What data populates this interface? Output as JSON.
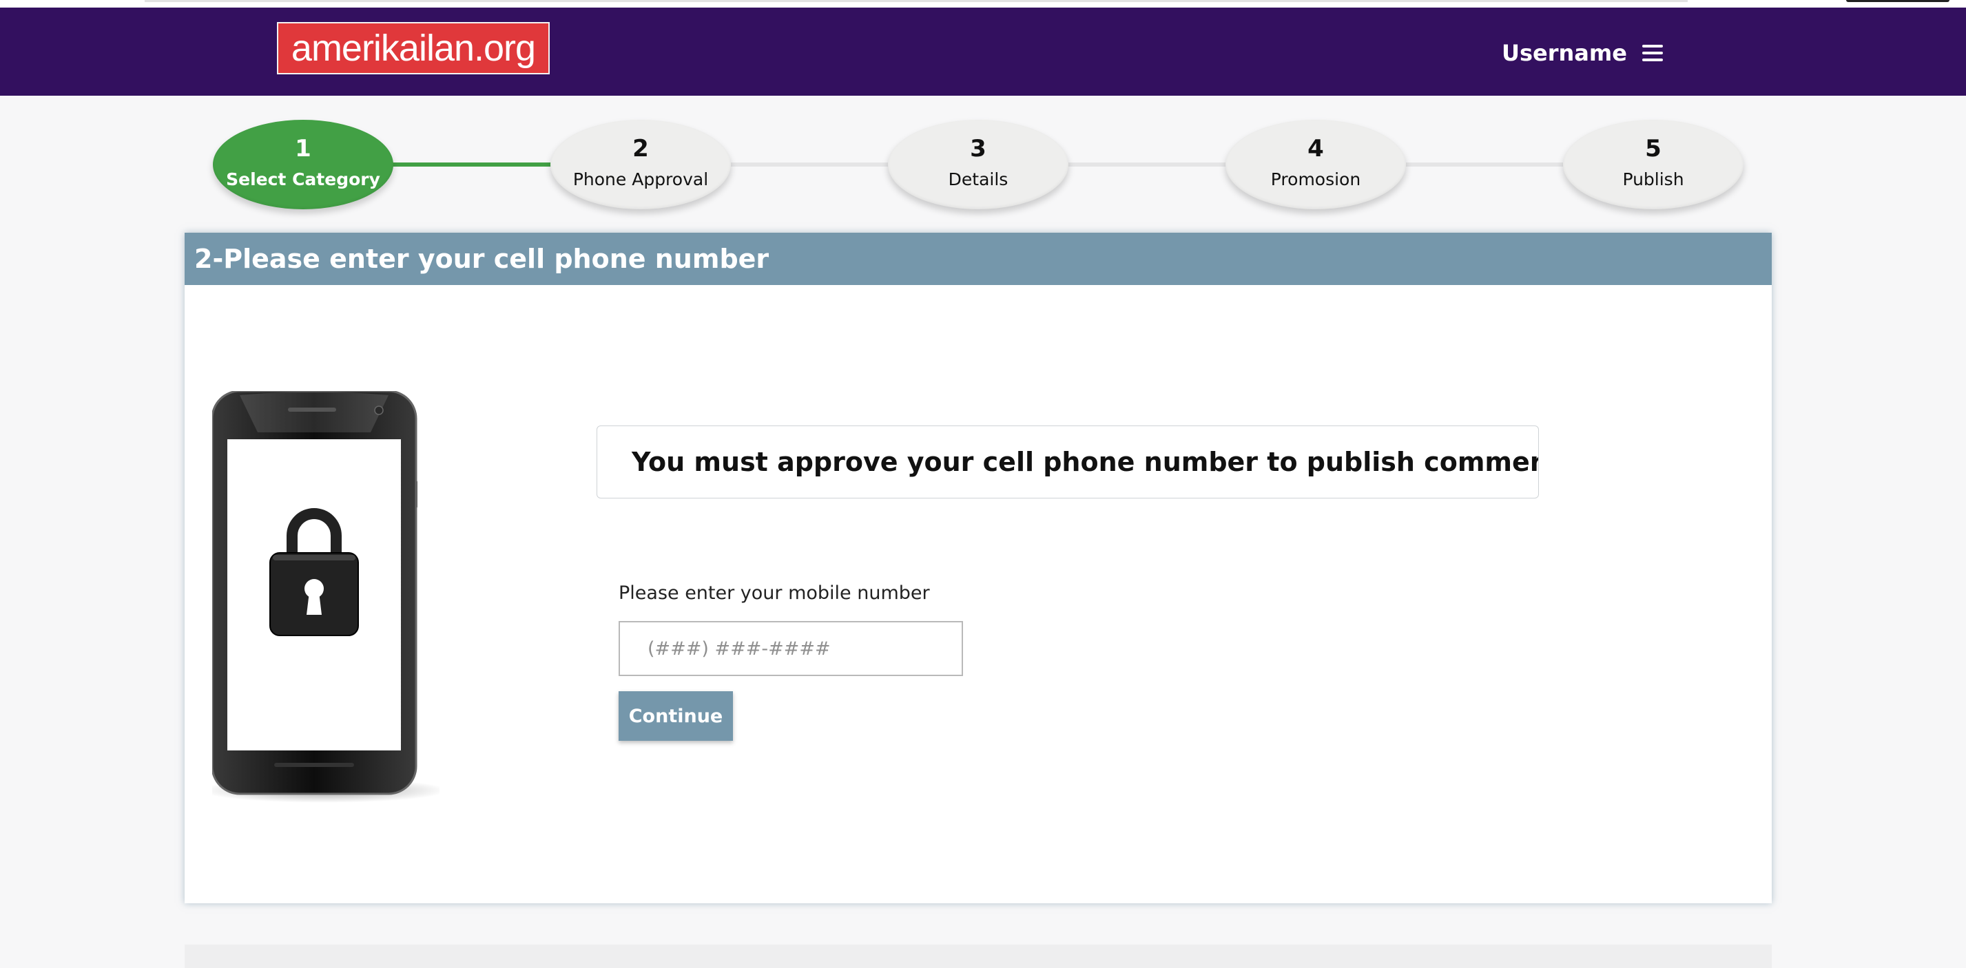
{
  "header": {
    "logo_text": "amerikailan.org",
    "username": "Username",
    "menu_icon": "hamburger-menu-icon"
  },
  "steps": [
    {
      "number": "1",
      "label": "Select Category",
      "state": "active"
    },
    {
      "number": "2",
      "label": "Phone Approval",
      "state": "upcoming"
    },
    {
      "number": "3",
      "label": "Details",
      "state": "upcoming"
    },
    {
      "number": "4",
      "label": "Promosion",
      "state": "upcoming"
    },
    {
      "number": "5",
      "label": "Publish",
      "state": "upcoming"
    }
  ],
  "panel": {
    "title": "2-Please enter your cell phone number",
    "notice": "You must approve your cell phone number to publish commercial",
    "illustration_icon": "phone-lock-icon",
    "phone_field": {
      "label": "Please enter your mobile number",
      "placeholder": "(###) ###-####",
      "value": ""
    },
    "continue_label": "Continue"
  },
  "colors": {
    "topbar": "#33105f",
    "logo": "#e0383b",
    "active_step": "#42a045",
    "panel_header": "#7597ab"
  }
}
